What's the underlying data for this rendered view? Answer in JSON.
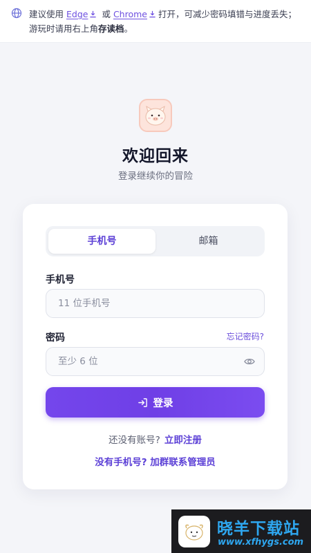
{
  "banner": {
    "text_before": "建议使用",
    "edge_label": "Edge",
    "or_text": "或",
    "chrome_label": "Chrome",
    "text_middle": "打开，可减少密码填错与进度丢失；游玩时请用右上角",
    "save_label": "存读档",
    "text_end": "。"
  },
  "header": {
    "title": "欢迎回来",
    "subtitle": "登录继续你的冒险"
  },
  "tabs": [
    {
      "label": "手机号",
      "active": true
    },
    {
      "label": "邮箱",
      "active": false
    }
  ],
  "form": {
    "phone_label": "手机号",
    "phone_placeholder": "11 位手机号",
    "password_label": "密码",
    "forgot_label": "忘记密码?",
    "password_placeholder": "至少 6 位",
    "login_label": "登录"
  },
  "footer": {
    "no_account_text": "还没有账号?",
    "register_label": "立即注册",
    "contact_label": "没有手机号? 加群联系管理员"
  },
  "watermark": {
    "name": "晓羊下载站",
    "url": "www.xfhygs.com"
  },
  "colors": {
    "accent": "#6f3fe6",
    "link": "#5b3fd6",
    "background": "#f4f5f9"
  }
}
